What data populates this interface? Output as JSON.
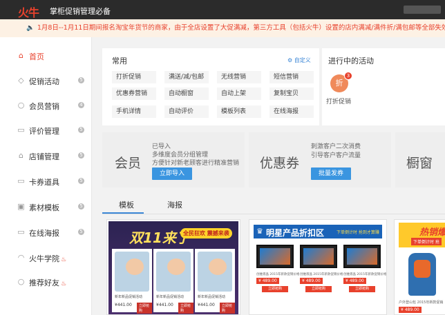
{
  "header": {
    "logo": "火牛",
    "slogan": "掌柜促销管理必备"
  },
  "notice": {
    "text": "1月8日--1月11日期间报名淘宝年货节的商家，由于全店设置了大促满减，第三方工具（包括火牛）设置的店内满减/满件折/满包邮等全部失效。非报名商"
  },
  "sidebar": {
    "items": [
      {
        "label": "首页",
        "icon": "home-icon"
      },
      {
        "label": "促销活动",
        "icon": "tag-icon",
        "badge": "5"
      },
      {
        "label": "会员营销",
        "icon": "user-icon",
        "badge": "4"
      },
      {
        "label": "评价管理",
        "icon": "comment-icon",
        "badge": "5"
      },
      {
        "label": "店铺管理",
        "icon": "shop-icon",
        "badge": "5"
      },
      {
        "label": "卡券道具",
        "icon": "card-icon",
        "badge": "5"
      },
      {
        "label": "素材模板",
        "icon": "image-icon",
        "badge": "5"
      },
      {
        "label": "在线海报",
        "icon": "poster-icon",
        "badge": "5"
      },
      {
        "label": "火牛学院",
        "icon": "graduation-icon"
      },
      {
        "label": "推荐好友",
        "icon": "friend-icon"
      }
    ]
  },
  "common": {
    "title": "常用",
    "custom": "自定义",
    "tools": [
      "打折促销",
      "满送/减/包邮",
      "无线营销",
      "短信营销",
      "优惠券营销",
      "自动橱窗",
      "自动上架",
      "复制宝贝",
      "手机详情",
      "自动评价",
      "模板列表",
      "在线海报"
    ]
  },
  "activity": {
    "title": "进行中的活动",
    "icon_text": "折",
    "count": "3",
    "label": "打折促销"
  },
  "features": {
    "member": {
      "title": "会员",
      "lines": [
        "已导入",
        "多维度会员分组管理",
        "方便针对新老顾客进行精准营销"
      ],
      "button": "立即导入"
    },
    "coupon": {
      "title": "优惠券",
      "lines": [
        "刺激客户二次消费",
        "引导客户客户流量"
      ],
      "button": "批量发券"
    },
    "window": {
      "title": "橱窗"
    }
  },
  "tabs": [
    "模板",
    "海报"
  ],
  "templates": {
    "t1": {
      "title": "双11来了",
      "tag": "全民狂欢 震撼来袭",
      "price": "¥441.00",
      "buy": "立即抢购",
      "ptxt": "新年新品促销活动"
    },
    "t2": {
      "title": "明星产品折扣区",
      "sub": "下单倒计时 抢到才算赚",
      "price": "¥ 489.00",
      "buy": "立即抢购",
      "txt": "创维液晶 2015年新款促销价格"
    },
    "t3": {
      "title": "热销爆",
      "sub": "下单倒计时 抢",
      "price": "¥ 489.00",
      "txt": "户外登山包 2015年新款促销"
    }
  }
}
